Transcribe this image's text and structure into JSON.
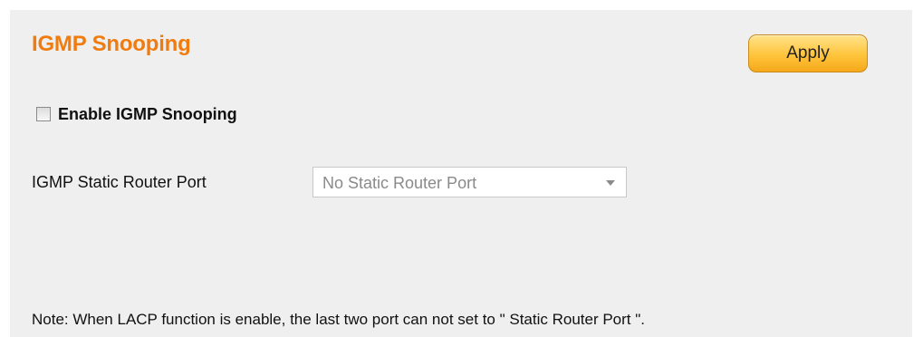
{
  "header": {
    "title": "IGMP Snooping",
    "apply_label": "Apply"
  },
  "enable": {
    "label": "Enable IGMP Snooping",
    "checked": false
  },
  "static_router_port": {
    "label": "IGMP Static Router Port",
    "selected": "No Static Router Port"
  },
  "note": "Note: When LACP function is enable, the last two port can not set to \" Static Router Port \".",
  "colors": {
    "title": "#f07c10",
    "panel_background": "#efefef",
    "apply_button": "#ffc43b"
  }
}
